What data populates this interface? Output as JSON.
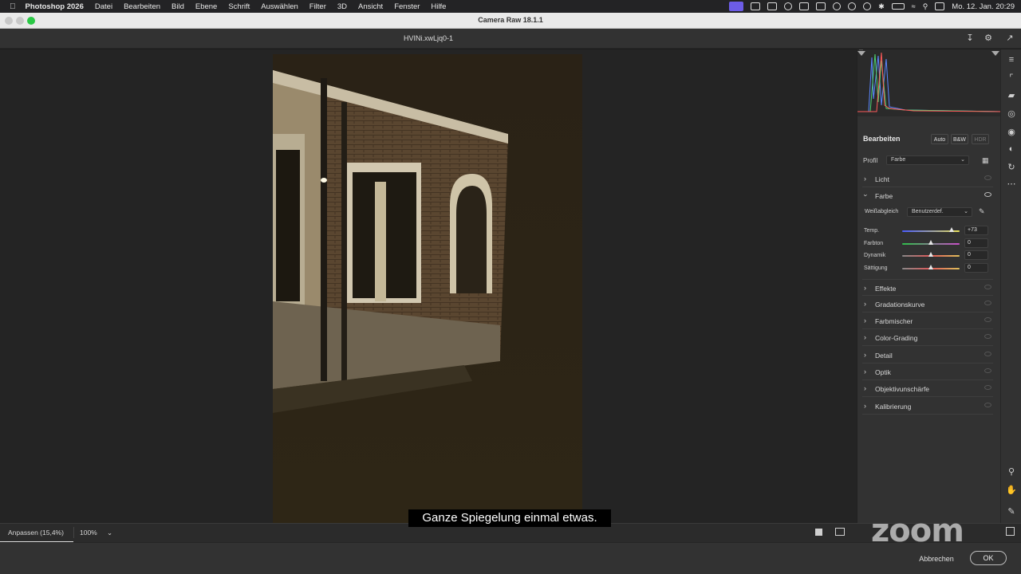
{
  "menubar": {
    "apple": "",
    "app": "Photoshop 2026",
    "items": [
      "Datei",
      "Bearbeiten",
      "Bild",
      "Ebene",
      "Schrift",
      "Auswählen",
      "Filter",
      "3D",
      "Ansicht",
      "Fenster",
      "Hilfe"
    ],
    "clock": "Mo. 12. Jan. 20:29"
  },
  "window": {
    "title": "Camera Raw 18.1.1"
  },
  "file": {
    "name": "HVINi.xwLjq0-1"
  },
  "panel": {
    "heading": "Bearbeiten",
    "auto_label": "Auto",
    "bw_label": "B&W",
    "hdr_label": "HDR",
    "profile_label": "Profil",
    "profile_value": "Farbe",
    "sections_top": [
      "Licht"
    ],
    "farbe_label": "Farbe",
    "whitebalance_label": "Weißabgleich",
    "whitebalance_value": "Benutzerdef.",
    "sliders": [
      {
        "label": "Temp.",
        "value": "+73",
        "level": 0.86
      },
      {
        "label": "Farbton",
        "value": "0",
        "level": 0.5
      },
      {
        "label": "Dynamik",
        "value": "0",
        "level": 0.5
      },
      {
        "label": "Sättigung",
        "value": "0",
        "level": 0.5
      }
    ],
    "sections_bottom": [
      "Effekte",
      "Gradationskurve",
      "Farbmischer",
      "Color-Grading",
      "Detail",
      "Optik",
      "Objektivunschärfe",
      "Kalibrierung"
    ]
  },
  "status": {
    "fit_label": "Anpassen (15,4%)",
    "zoom_label": "100%"
  },
  "footer": {
    "cancel_label": "Abbrechen",
    "ok_label": "OK"
  },
  "subtitle": "Ganze Spiegelung einmal etwas.",
  "zoom_watermark": "zoom",
  "colors": {
    "accent": "#6c5ce7",
    "panel_bg": "#323232",
    "canvas_bg": "#242424"
  }
}
